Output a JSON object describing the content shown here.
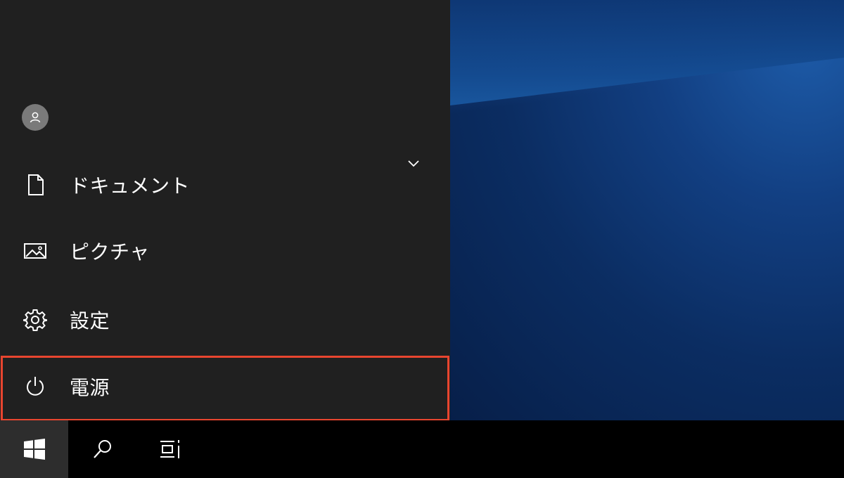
{
  "start_menu": {
    "items": [
      {
        "label": "ドキュメント",
        "icon": "document-icon"
      },
      {
        "label": "ピクチャ",
        "icon": "pictures-icon"
      },
      {
        "label": "設定",
        "icon": "gear-icon"
      },
      {
        "label": "電源",
        "icon": "power-icon"
      }
    ],
    "highlight_color": "#e8452f"
  },
  "taskbar": {
    "icons": [
      "windows-logo-icon",
      "search-icon",
      "task-view-icon"
    ]
  },
  "colors": {
    "menu_background": "#202020",
    "taskbar_background": "#000000",
    "start_button_background": "#2d2d2d",
    "desktop_accent": "#123f82"
  }
}
